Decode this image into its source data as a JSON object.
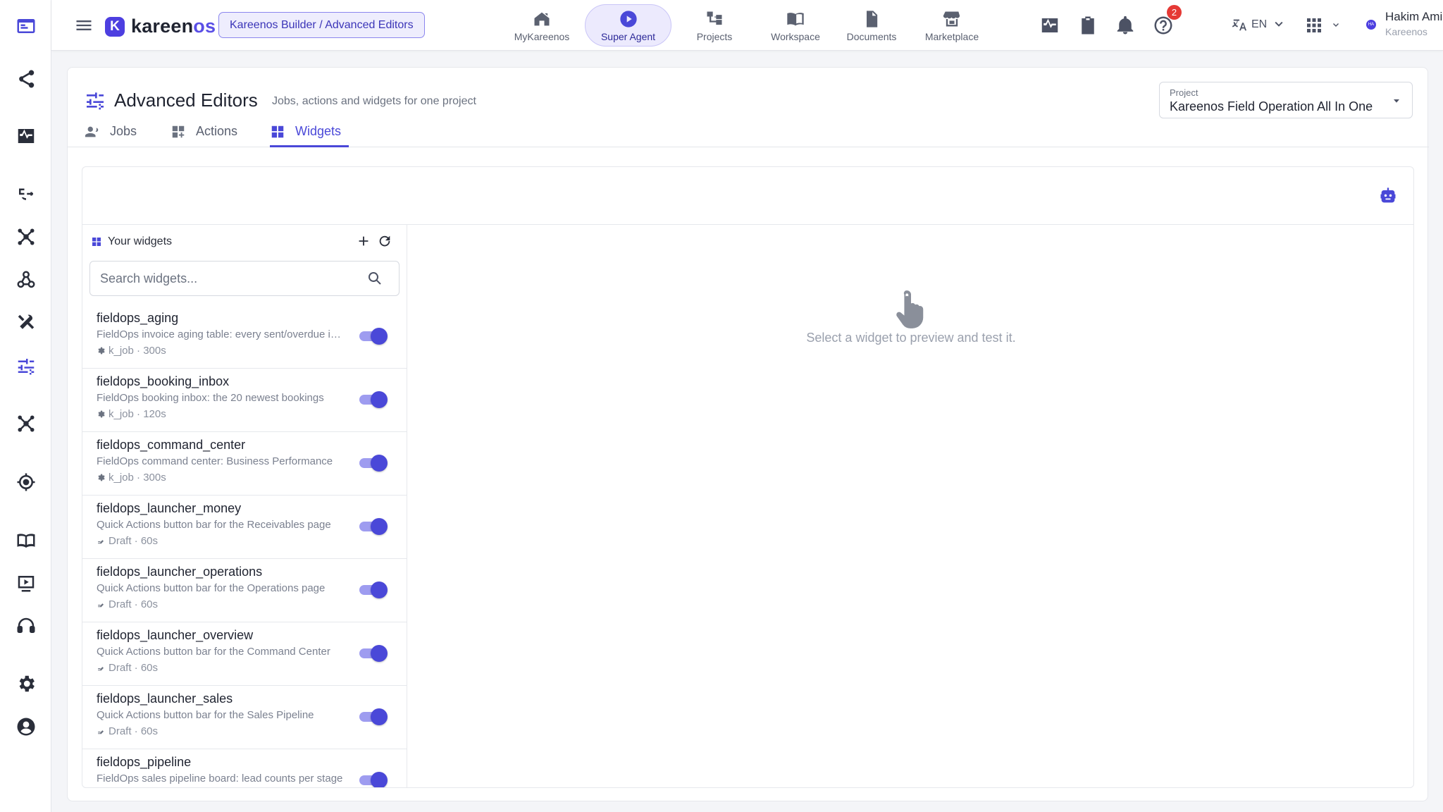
{
  "app": {
    "logo_text": "kareen",
    "logo_suffix": "os",
    "logo_mark": "K",
    "breadcrumb": "Kareenos Builder / Advanced Editors"
  },
  "nav": [
    {
      "label": "MyKareenos",
      "icon": "home-icon"
    },
    {
      "label": "Super Agent",
      "icon": "play-circle-icon",
      "active": true
    },
    {
      "label": "Projects",
      "icon": "hierarchy-icon"
    },
    {
      "label": "Workspace",
      "icon": "book-open-icon"
    },
    {
      "label": "Documents",
      "icon": "document-icon"
    },
    {
      "label": "Marketplace",
      "icon": "store-icon"
    }
  ],
  "topbar": {
    "notifications_count": "2",
    "language": "EN",
    "user_name": "Hakim Amir",
    "user_org": "Kareenos",
    "avatar_initials": "HA"
  },
  "page": {
    "title": "Advanced Editors",
    "subtitle": "Jobs, actions and widgets for one project",
    "project_label": "Project",
    "project_value": "Kareenos Field Operation All In One"
  },
  "tabs": [
    {
      "label": "Jobs",
      "icon": "users-cog-icon"
    },
    {
      "label": "Actions",
      "icon": "grid-plus-icon"
    },
    {
      "label": "Widgets",
      "icon": "widgets-icon",
      "active": true
    }
  ],
  "widgets_panel": {
    "header": "Your widgets",
    "search_placeholder": "Search widgets...",
    "items": [
      {
        "name": "fieldops_aging",
        "desc": "FieldOps invoice aging table: every sent/overdue invoice",
        "meta": "k_job · 300s",
        "meta_icon": "gear-icon",
        "enabled": true
      },
      {
        "name": "fieldops_booking_inbox",
        "desc": "FieldOps booking inbox: the 20 newest bookings",
        "meta": "k_job · 120s",
        "meta_icon": "gear-icon",
        "enabled": true
      },
      {
        "name": "fieldops_command_center",
        "desc": "FieldOps command center: Business Performance",
        "meta": "k_job · 300s",
        "meta_icon": "gear-icon",
        "enabled": true
      },
      {
        "name": "fieldops_launcher_money",
        "desc": "Quick Actions button bar for the Receivables page",
        "meta": "Draft · 60s",
        "meta_icon": "draft-icon",
        "enabled": true
      },
      {
        "name": "fieldops_launcher_operations",
        "desc": "Quick Actions button bar for the Operations page",
        "meta": "Draft · 60s",
        "meta_icon": "draft-icon",
        "enabled": true
      },
      {
        "name": "fieldops_launcher_overview",
        "desc": "Quick Actions button bar for the Command Center",
        "meta": "Draft · 60s",
        "meta_icon": "draft-icon",
        "enabled": true
      },
      {
        "name": "fieldops_launcher_sales",
        "desc": "Quick Actions button bar for the Sales Pipeline",
        "meta": "Draft · 60s",
        "meta_icon": "draft-icon",
        "enabled": true
      },
      {
        "name": "fieldops_pipeline",
        "desc": "FieldOps sales pipeline board: lead counts per stage",
        "meta": "",
        "meta_icon": "draft-icon",
        "enabled": true
      }
    ]
  },
  "preview": {
    "empty_text": "Select a widget to preview and test it."
  },
  "colors": {
    "accent": "#4a48d8",
    "accent_light": "#eceafd",
    "badge": "#e53935"
  }
}
